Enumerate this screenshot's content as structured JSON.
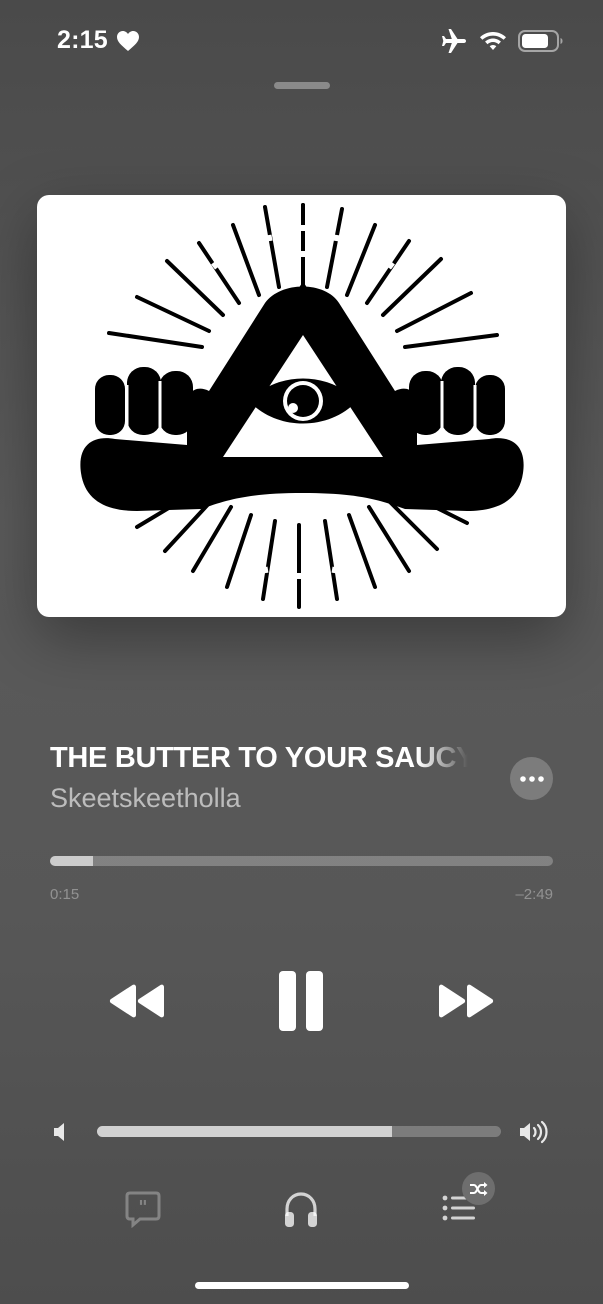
{
  "status_bar": {
    "time": "2:15",
    "icons": [
      "heart-icon",
      "airplane-icon",
      "wifi-icon",
      "battery-icon"
    ]
  },
  "artwork": {
    "icon": "illuminati-eye-hands-art"
  },
  "now_playing": {
    "title": "THE BUTTER TO YOUR SAUCY",
    "artist": "Skeetskeetholla"
  },
  "playback": {
    "elapsed": "0:15",
    "remaining": "–2:49",
    "progress_fraction": 0.085
  },
  "volume": {
    "level_fraction": 0.73
  },
  "controls": {
    "rewind": "backward-icon",
    "pause": "pause-icon",
    "forward": "forward-icon"
  },
  "bottom_bar": {
    "lyrics": "lyrics-quote-bubble-icon",
    "airplay": "headphones-icon",
    "queue": "list-icon",
    "shuffle": "shuffle-icon"
  },
  "colors": {
    "background": "#555555",
    "primary_text": "#ffffff",
    "secondary_text": "#a6a6a6"
  }
}
